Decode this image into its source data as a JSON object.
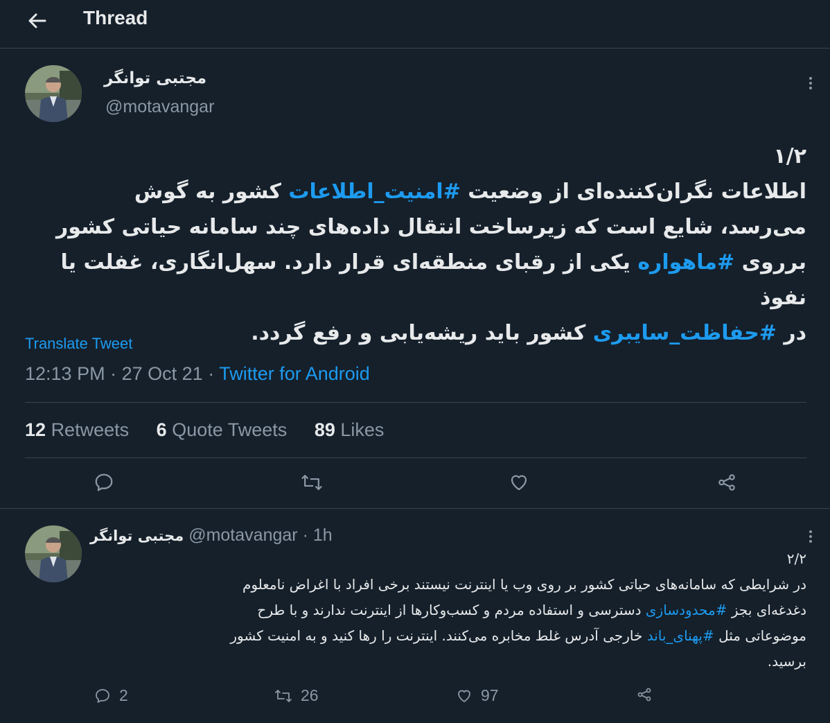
{
  "header": {
    "title": "Thread"
  },
  "main_tweet": {
    "display_name": "مجتبی توانگر",
    "handle": "@motavangar",
    "lines": [
      [
        {
          "t": "۱/۲"
        }
      ],
      [
        {
          "t": "اطلاعات نگران‌کننده‌ای از وضعیت "
        },
        {
          "t": "#امنیت_اطلاعات",
          "tag": true
        },
        {
          "t": " کشور به گوش"
        }
      ],
      [
        {
          "t": "می‌رسد، شایع است که زیرساخت انتقال داده‌های چند سامانه حیاتی کشور"
        }
      ],
      [
        {
          "t": "برروی "
        },
        {
          "t": "#ماهواره",
          "tag": true
        },
        {
          "t": " یکی از رقبای منطقه‌ای قرار دارد. سهل‌انگاری، غفلت یا نفوذ"
        }
      ],
      [
        {
          "t": "در "
        },
        {
          "t": "#حفاظت_سایبری",
          "tag": true
        },
        {
          "t": " کشور باید ریشه‌یابی و رفع گردد."
        }
      ]
    ],
    "translate_label": "Translate Tweet",
    "time": "12:13 PM",
    "date": "27 Oct 21",
    "source": "Twitter for Android",
    "stats": {
      "retweets_count": "12",
      "retweets_label": "Retweets",
      "quotes_count": "6",
      "quotes_label": "Quote Tweets",
      "likes_count": "89",
      "likes_label": "Likes"
    }
  },
  "reply_tweet": {
    "display_name": "مجتبی توانگر",
    "handle": "@motavangar",
    "time_ago": "1h",
    "lines": [
      [
        {
          "t": "۲/۲"
        }
      ],
      [
        {
          "t": "در شرایطی که سامانه‌های حیاتی کشور بر روی وب یا اینترنت نیستند برخی افراد با اغراض نامعلوم"
        }
      ],
      [
        {
          "t": "دغدغه‌ای بجز "
        },
        {
          "t": "#محدودسازی",
          "tag": true
        },
        {
          "t": " دسترسی و استفاده مردم و کسب‌وکارها از اینترنت ندارند و با طرح"
        }
      ],
      [
        {
          "t": "موضوعاتی مثل "
        },
        {
          "t": "#پهنای_باند",
          "tag": true
        },
        {
          "t": " خارجی آدرس غلط مخابره می‌کنند. اینترنت را رها کنید و به امنیت کشور"
        }
      ],
      [
        {
          "t": "برسید."
        }
      ]
    ],
    "replies": "2",
    "retweets": "26",
    "likes": "97"
  },
  "colors": {
    "background": "#15202b",
    "text": "#e7e9ea",
    "secondary": "#8b98a5",
    "accent": "#1d9bf0",
    "border": "#38444d"
  },
  "icons": [
    "back-arrow-icon",
    "more-icon",
    "reply-icon",
    "retweet-icon",
    "like-icon",
    "share-icon"
  ]
}
